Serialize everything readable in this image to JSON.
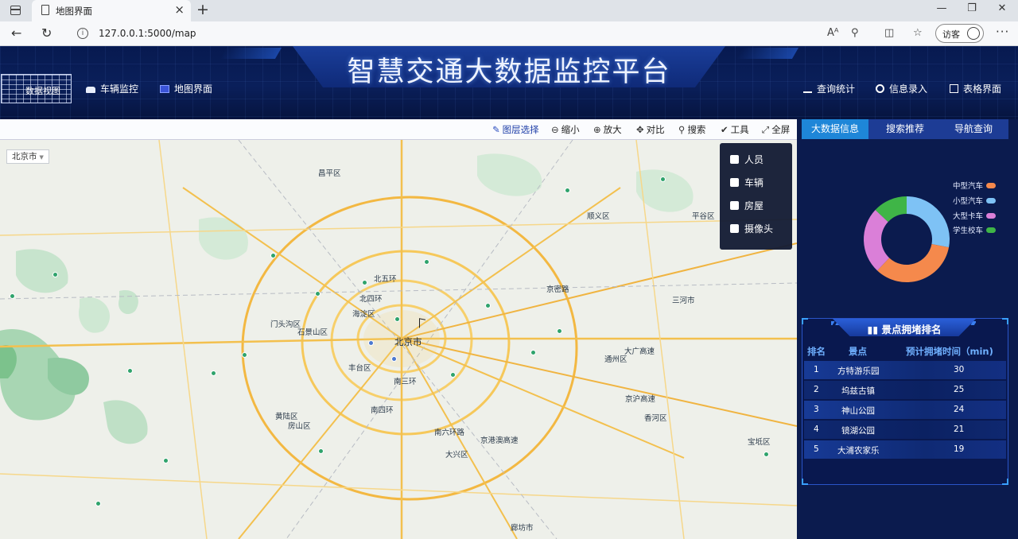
{
  "browser": {
    "tab_title": "地图界面",
    "tab_close": "×",
    "new_tab": "+",
    "url": "127.0.0.1:5000/map",
    "visitor_label": "访客",
    "win_min": "—",
    "win_max": "❐",
    "win_close": "✕"
  },
  "header": {
    "title": "智慧交通大数据监控平台",
    "logo_text": "数据视图",
    "nav_left": [
      {
        "label": "车辆监控",
        "icon": "car-icon"
      },
      {
        "label": "地图界面",
        "icon": "map-icon"
      }
    ],
    "nav_right": [
      {
        "label": "查询统计",
        "icon": "bar-chart-icon"
      },
      {
        "label": "信息录入",
        "icon": "gear-icon"
      },
      {
        "label": "表格界面",
        "icon": "table-icon"
      }
    ]
  },
  "map_toolbar": {
    "layers": "图层选择",
    "zoom_out": "缩小",
    "zoom_in": "放大",
    "compare": "对比",
    "search": "搜索",
    "tools": "工具",
    "fullscreen": "全屏"
  },
  "map": {
    "city_select": "北京市",
    "layer_options": [
      "人员",
      "车辆",
      "房屋",
      "摄像头"
    ],
    "labels": {
      "center": "北京市",
      "ring5": "北五环",
      "ring4": "北四环",
      "ring3": "南三环",
      "ring2": "南四环",
      "shijing": "石景山区",
      "fengtai": "丰台区",
      "haidian": "海淀区",
      "changping": "昌平区",
      "tongzhou": "通州区",
      "mentou": "门头沟区",
      "fangshan": "房山区",
      "daxing": "大兴区",
      "shunyi": "顺义区",
      "jingmi": "京密路",
      "langfang": "廊坊市",
      "sanhe": "三河市",
      "baodi": "宝坻区",
      "xiangHe": "香河区",
      "pinggu": "平谷区",
      "daguang": "大广高速",
      "jinghu": "京沪高速",
      "nanliu": "南六环路",
      "jinggang": "京港澳高速",
      "huanglu": "黄陆区"
    }
  },
  "right_panel": {
    "tabs": [
      "大数据信息",
      "搜索推荐",
      "导航查询"
    ],
    "active_tab": 0,
    "chart_data": {
      "type": "pie",
      "donut": true,
      "categories": [
        "中型汽车",
        "小型汽车",
        "大型卡车",
        "学生校车"
      ],
      "values": [
        34,
        28,
        25,
        13
      ],
      "colors": [
        "#f5894c",
        "#7ec2f5",
        "#da7fd8",
        "#3fb547"
      ],
      "legend_position": "right"
    },
    "ranking": {
      "title": "景点拥堵排名",
      "headers": [
        "排名",
        "景点",
        "预计拥堵时间（min)"
      ],
      "rows": [
        {
          "rank": "1",
          "name": "方特游乐园",
          "time": "30"
        },
        {
          "rank": "2",
          "name": "坞兹古镇",
          "time": "25"
        },
        {
          "rank": "3",
          "name": "神山公园",
          "time": "24"
        },
        {
          "rank": "4",
          "name": "镜湖公园",
          "time": "21"
        },
        {
          "rank": "5",
          "name": "大浦农家乐",
          "time": "19"
        }
      ]
    }
  }
}
